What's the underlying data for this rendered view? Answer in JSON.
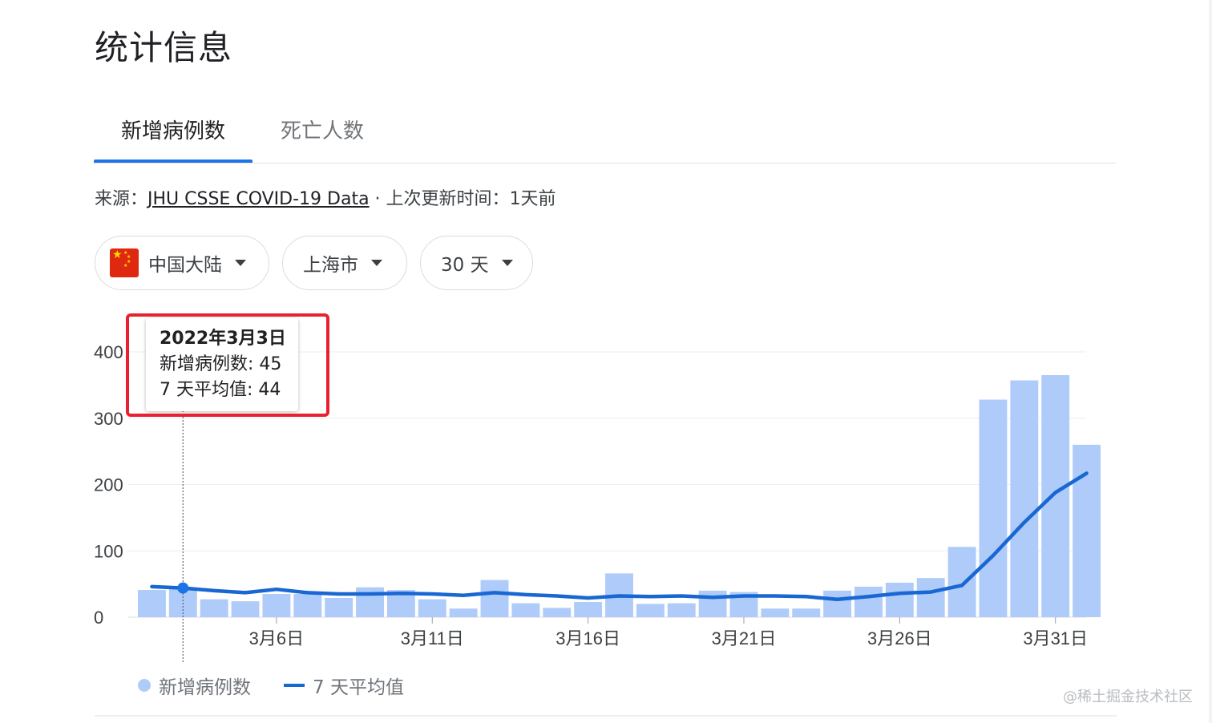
{
  "title": "统计信息",
  "tabs": [
    {
      "label": "新增病例数",
      "active": true
    },
    {
      "label": "死亡人数",
      "active": false
    }
  ],
  "source": {
    "prefix": "来源：",
    "link": "JHU CSSE COVID-19 Data",
    "separator": " · ",
    "updated_label": "上次更新时间：",
    "updated_value": "1天前"
  },
  "filters": {
    "region": "中国大陆",
    "city": "上海市",
    "range": "30 天"
  },
  "tooltip": {
    "date": "2022年3月3日",
    "cases_label": "新增病例数",
    "cases_value": "45",
    "avg_label": "7 天平均值",
    "avg_value": "44"
  },
  "legend": {
    "bars": "新增病例数",
    "line": "7 天平均值"
  },
  "watermark": "@稀土掘金技术社区",
  "colors": {
    "bar": "#aecbfa",
    "line": "#1967d2",
    "accent": "#1a73e8",
    "highlight": "#e8202f"
  },
  "chart_data": {
    "type": "bar",
    "ylim": [
      0,
      400
    ],
    "yticks": [
      0,
      100,
      200,
      300,
      400
    ],
    "grid": true,
    "legend_position": "bottom-left",
    "xtick_labels": [
      {
        "index": 4,
        "label": "3月6日"
      },
      {
        "index": 9,
        "label": "3月11日"
      },
      {
        "index": 14,
        "label": "3月16日"
      },
      {
        "index": 19,
        "label": "3月21日"
      },
      {
        "index": 24,
        "label": "3月26日"
      },
      {
        "index": 29,
        "label": "3月31日"
      }
    ],
    "highlight_index": 1,
    "series": [
      {
        "name": "新增病例数",
        "kind": "bar",
        "values": [
          41,
          45,
          27,
          24,
          35,
          35,
          29,
          45,
          41,
          27,
          13,
          56,
          21,
          14,
          23,
          66,
          20,
          21,
          40,
          38,
          13,
          13,
          40,
          46,
          52,
          59,
          106,
          328,
          357,
          365,
          260
        ]
      },
      {
        "name": "7 天平均值",
        "kind": "line",
        "values": [
          46,
          44,
          40,
          37,
          42,
          37,
          35,
          35,
          36,
          35,
          33,
          37,
          34,
          32,
          29,
          32,
          31,
          32,
          30,
          32,
          32,
          31,
          27,
          31,
          36,
          38,
          48,
          93,
          143,
          188,
          217
        ]
      }
    ]
  }
}
